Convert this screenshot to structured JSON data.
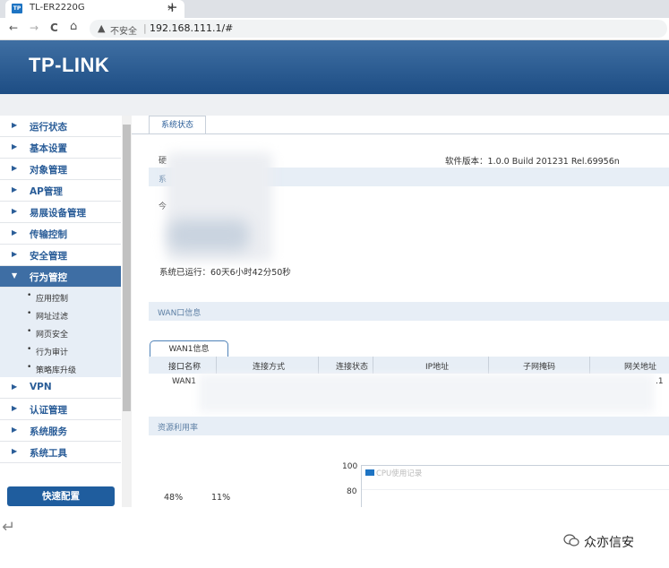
{
  "browser": {
    "tab_title": "TL-ER2220G",
    "tab_close": "×",
    "new_tab": "+",
    "security_label": "不安全",
    "url": "192.168.111.1/#",
    "nav": {
      "back": "←",
      "forward": "→",
      "reload": "C",
      "home": "⌂"
    }
  },
  "header": {
    "logo": "TP-LINK"
  },
  "sidebar": {
    "items": [
      {
        "label": "运行状态"
      },
      {
        "label": "基本设置"
      },
      {
        "label": "对象管理"
      },
      {
        "label": "AP管理"
      },
      {
        "label": "易展设备管理"
      },
      {
        "label": "传输控制"
      },
      {
        "label": "安全管理"
      },
      {
        "label": "行为管控",
        "active": true
      },
      {
        "label": "VPN"
      },
      {
        "label": "认证管理"
      },
      {
        "label": "系统服务"
      },
      {
        "label": "系统工具"
      }
    ],
    "subitems": [
      {
        "label": "应用控制"
      },
      {
        "label": "网址过滤"
      },
      {
        "label": "网页安全"
      },
      {
        "label": "行为审计"
      },
      {
        "label": "策略库升级"
      }
    ],
    "quick_config": "快速配置"
  },
  "main": {
    "tab": "系统状态",
    "software_version": "软件版本：1.0.0 Build 201231 Rel.69956n",
    "partial_1": "硬",
    "partial_2": "系",
    "partial_3": "今",
    "uptime": "系统已运行：60天6小时42分50秒",
    "wan_section": "WAN口信息",
    "wan_tab": "WAN1信息",
    "wan_columns": [
      "接口名称",
      "连接方式",
      "连接状态",
      "IP地址",
      "子网掩码",
      "网关地址"
    ],
    "wan_rows": [
      {
        "name": "WAN1",
        "tail": ".1"
      }
    ],
    "resource_section": "资源利用率",
    "cpu_percent": "48%",
    "mem_percent": "11%",
    "chart": {
      "ticks": [
        "100",
        "80"
      ],
      "legend": "CPU使用记录"
    }
  },
  "watermark": "众亦信安",
  "return_glyph": "↵"
}
